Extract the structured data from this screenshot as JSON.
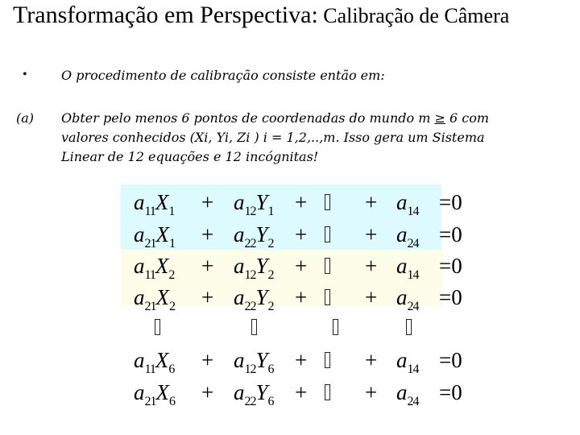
{
  "title": {
    "main": "Transformação em Perspectiva:",
    "sub": " Calibração de Câmera"
  },
  "bullet": {
    "symbol": "•",
    "text": "O procedimento de calibração consiste então em:"
  },
  "item_a": {
    "marker": "(a)",
    "line1_pre": "Obter pelo menos 6 pontos de coordenadas do mundo m ",
    "line1_ge": "≥",
    "line1_post": " 6 com",
    "line2": "valores conhecidos (Xi, Yi, Zi ) i = 1,2,..,m. Isso gera um  Sistema",
    "line3": "Linear de 12 equações e 12 incógnitas!"
  },
  "highlights": {
    "cyan": "#ddfbff",
    "yellow": "#fdfde9"
  },
  "equations": {
    "rows": [
      {
        "c1v": "a",
        "c1s": "11",
        "c1x": "X",
        "c1xs": "1",
        "c2v": "a",
        "c2s": "12",
        "c2y": "Y",
        "c2ys": "1",
        "c4v": "a",
        "c4s": "14",
        "eq": "= 0",
        "plus": "+",
        "group": "point-1"
      },
      {
        "c1v": "a",
        "c1s": "21",
        "c1x": "X",
        "c1xs": "1",
        "c2v": "a",
        "c2s": "22",
        "c2y": "Y",
        "c2ys": "2",
        "c4v": "a",
        "c4s": "24",
        "eq": "= 0",
        "plus": "+",
        "group": "point-1"
      },
      {
        "c1v": "a",
        "c1s": "11",
        "c1x": "X",
        "c1xs": "2",
        "c2v": "a",
        "c2s": "12",
        "c2y": "Y",
        "c2ys": "2",
        "c4v": "a",
        "c4s": "14",
        "eq": "= 0",
        "plus": "+",
        "group": "point-2"
      },
      {
        "c1v": "a",
        "c1s": "21",
        "c1x": "X",
        "c1xs": "2",
        "c2v": "a",
        "c2s": "22",
        "c2y": "Y",
        "c2ys": "2",
        "c4v": "a",
        "c4s": "24",
        "eq": "= 0",
        "plus": "+",
        "group": "point-2"
      },
      {
        "c1v": "a",
        "c1s": "11",
        "c1x": "X",
        "c1xs": "6",
        "c2v": "a",
        "c2s": "12",
        "c2y": "Y",
        "c2ys": "6",
        "c4v": "a",
        "c4s": "14",
        "eq": "= 0",
        "plus": "+",
        "group": "point-6"
      },
      {
        "c1v": "a",
        "c1s": "21",
        "c1x": "X",
        "c1xs": "6",
        "c2v": "a",
        "c2s": "22",
        "c2y": "Y",
        "c2ys": "6",
        "c4v": "a",
        "c4s": "24",
        "eq": "= 0",
        "plus": "+",
        "group": "point-6"
      }
    ],
    "missing_glyph": "missing-glyph-box",
    "vertical_dots_count": 4
  }
}
